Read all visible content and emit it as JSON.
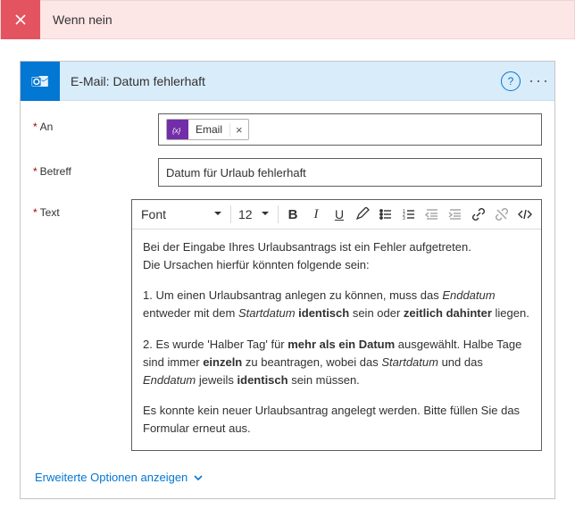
{
  "header": {
    "title": "Wenn nein"
  },
  "card": {
    "title": "E-Mail: Datum fehlerhaft",
    "help_tooltip": "?",
    "menu_label": "···"
  },
  "fields": {
    "to": {
      "label": "An",
      "token_icon": "fx",
      "token_label": "Email",
      "token_remove": "×"
    },
    "subject": {
      "label": "Betreff",
      "value": "Datum für Urlaub fehlerhaft"
    },
    "body": {
      "label": "Text"
    }
  },
  "rte": {
    "font_label": "Font",
    "size_label": "12",
    "buttons": {
      "bold": "B",
      "italic": "I",
      "underline": "U"
    }
  },
  "body_text": {
    "p1_a": "Bei der Eingabe Ihres Urlaubsantrags ist ein Fehler aufgetreten.",
    "p1_b": "Die Ursachen hierfür könnten folgende sein:",
    "p2_a": "1. Um einen Urlaubsantrag anlegen zu können, muss das ",
    "p2_b": "Enddatum",
    "p2_c": " entweder mit dem ",
    "p2_d": "Startdatum",
    "p2_e": " identisch",
    "p2_f": " sein oder ",
    "p2_g": "zeitlich dahinter",
    "p2_h": " liegen.",
    "p3_a": "2. Es wurde 'Halber Tag' für ",
    "p3_b": "mehr als ein Datum",
    "p3_c": " ausgewählt. Halbe Tage sind immer ",
    "p3_d": "einzeln",
    "p3_e": " zu beantragen, wobei das ",
    "p3_f": "Startdatum",
    "p3_g": " und das ",
    "p3_h": "Enddatum",
    "p3_i": " jeweils ",
    "p3_j": "identisch",
    "p3_k": " sein müssen.",
    "p4": "Es konnte kein neuer Urlaubsantrag angelegt werden. Bitte füllen Sie das Formular erneut aus."
  },
  "footer": {
    "advanced": "Erweiterte Optionen anzeigen"
  }
}
